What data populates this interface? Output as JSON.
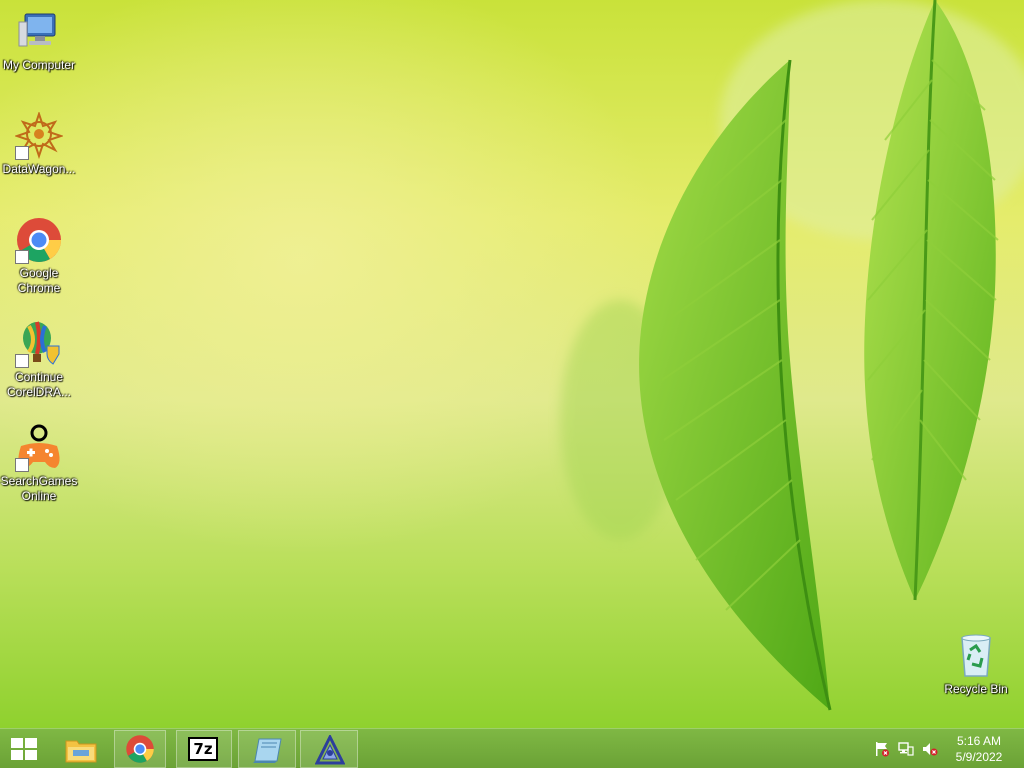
{
  "desktop": {
    "icons": [
      {
        "label": "My Computer",
        "icon": "computer-icon"
      },
      {
        "label": "DataWagon...",
        "icon": "datawagon-icon"
      },
      {
        "label": "Google Chrome",
        "icon": "chrome-icon"
      },
      {
        "label": "Continue CorelDRA...",
        "icon": "coreldraw-icon"
      },
      {
        "label": "SearchGames Online",
        "icon": "gamepad-icon"
      },
      {
        "label": "Recycle Bin",
        "icon": "recycle-bin-icon"
      }
    ]
  },
  "taskbar": {
    "start": {
      "icon": "windows-logo-icon"
    },
    "apps": [
      {
        "name": "File Explorer",
        "icon": "file-explorer-icon"
      },
      {
        "name": "Google Chrome",
        "icon": "chrome-icon"
      },
      {
        "name": "7-Zip",
        "icon": "7zip-icon",
        "text": "7z"
      },
      {
        "name": "Notebook",
        "icon": "notebook-icon"
      },
      {
        "name": "Aptana",
        "icon": "aptana-icon"
      }
    ],
    "tray": {
      "icons": [
        "action-center-flag-icon",
        "network-icon",
        "volume-muted-icon"
      ],
      "time": "5:16 AM",
      "date": "5/9/2022"
    }
  },
  "colors": {
    "taskbar": "#72aa3a",
    "wallpaper_light": "#e5ec6c",
    "leaf": "#6cbf25"
  }
}
